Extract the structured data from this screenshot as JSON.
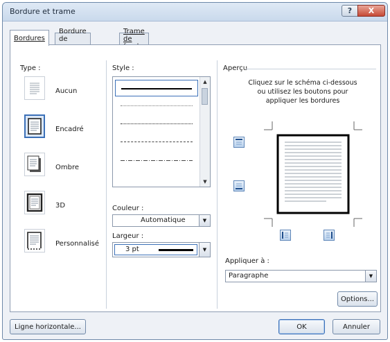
{
  "window": {
    "title": "Bordure et trame",
    "help_glyph": "?",
    "close_glyph": "X"
  },
  "tabs": [
    {
      "label": "Bordures",
      "active": true
    },
    {
      "label": "Bordure de page",
      "active": false
    },
    {
      "label": "Trame de fond",
      "active": false
    }
  ],
  "type": {
    "heading": "Type :",
    "items": [
      {
        "label": "Aucun",
        "icon": "border-none-icon",
        "selected": false
      },
      {
        "label": "Encadré",
        "icon": "border-box-icon",
        "selected": true
      },
      {
        "label": "Ombre",
        "icon": "border-shadow-icon",
        "selected": false
      },
      {
        "label": "3D",
        "icon": "border-3d-icon",
        "selected": false
      },
      {
        "label": "Personnalisé",
        "icon": "border-custom-icon",
        "selected": false
      }
    ]
  },
  "style": {
    "heading": "Style :",
    "options": [
      "solid",
      "dotted",
      "dense-dotted",
      "dashed",
      "dash-dot"
    ],
    "selected": "solid"
  },
  "color": {
    "label": "Couleur :",
    "value": "Automatique"
  },
  "width": {
    "label": "Largeur :",
    "value": "3 pt"
  },
  "preview": {
    "heading": "Aperçu",
    "instructions": [
      "Cliquez sur le schéma ci-dessous",
      "ou utilisez les boutons pour",
      "appliquer les bordures"
    ]
  },
  "apply_to": {
    "label": "Appliquer à :",
    "value": "Paragraphe"
  },
  "buttons": {
    "options": "Options...",
    "horizontal_line": "Ligne horizontale...",
    "ok": "OK",
    "cancel": "Annuler"
  },
  "colors": {
    "accent": "#3b70b8",
    "close": "#c64a36"
  }
}
